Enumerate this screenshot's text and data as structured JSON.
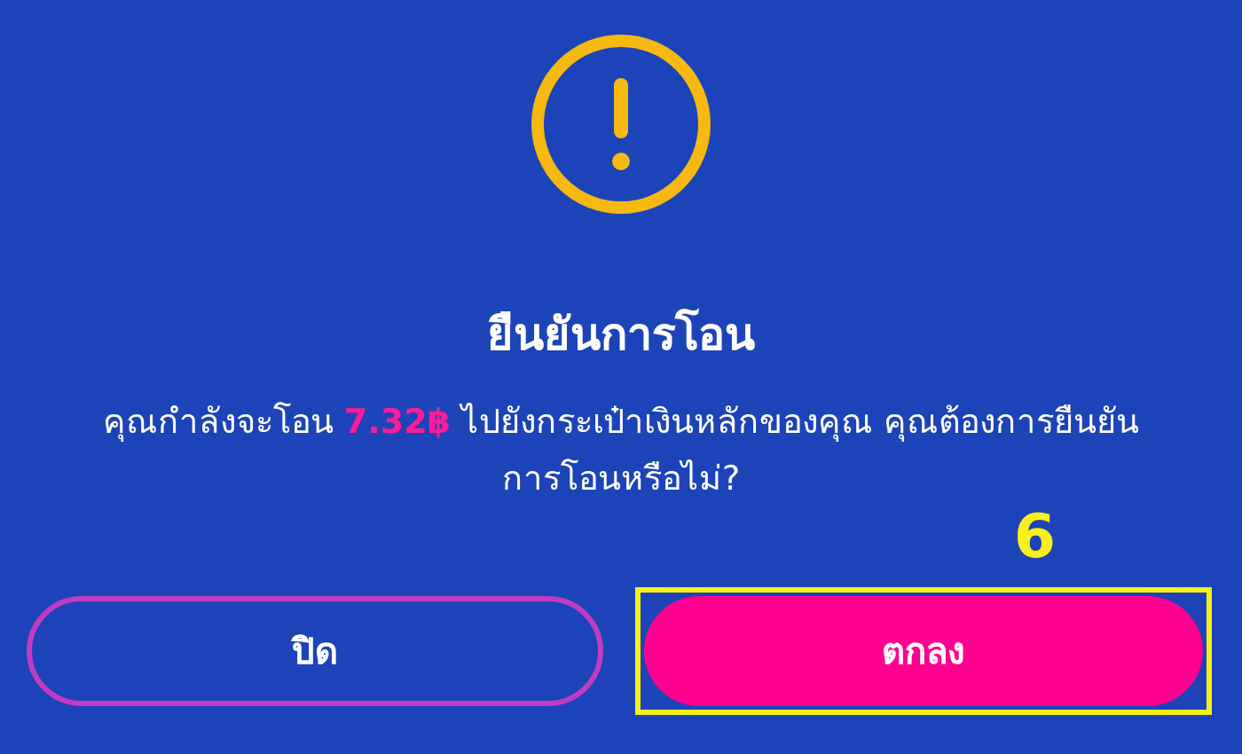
{
  "dialog": {
    "title": "ยืนยันการโอน",
    "message": "คุณกำลังจะโอน **7.32฿** ไปยังกระเป๋าเงินหลักของคุณ คุณต้องการยืนยันการโอนหรือไม่?"
  },
  "buttons": [
    {
      "label": "ปิด",
      "kind": "outline",
      "highlighted": false
    },
    {
      "label": "ตกลง",
      "kind": "filled",
      "highlighted": true
    }
  ],
  "annotation": {
    "label": "6"
  }
}
